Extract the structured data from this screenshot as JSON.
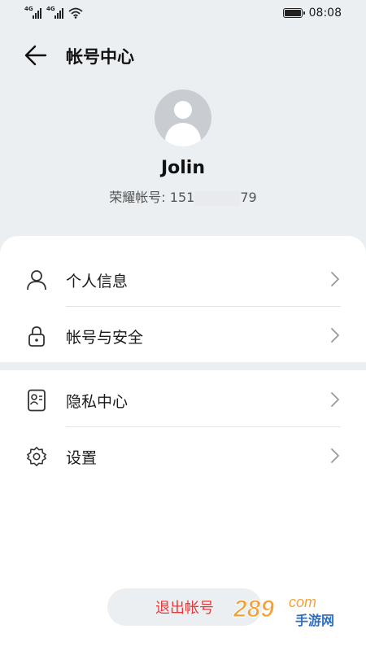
{
  "status_bar": {
    "network_1": "4G",
    "network_2": "4G",
    "time": "08:08",
    "icons": [
      "signal-icon",
      "signal-icon",
      "wifi-icon",
      "battery-icon"
    ]
  },
  "header": {
    "back_icon": "arrow-left-icon",
    "title": "帐号中心"
  },
  "profile": {
    "avatar_icon": "default-avatar-icon",
    "name": "Jolin",
    "account_label": "荣耀帐号: ",
    "account_prefix": "151",
    "account_suffix": "79"
  },
  "menu_group_1": [
    {
      "icon": "person-icon",
      "label": "个人信息"
    },
    {
      "icon": "lock-icon",
      "label": "帐号与安全"
    }
  ],
  "menu_group_2": [
    {
      "icon": "id-card-icon",
      "label": "隐私中心"
    },
    {
      "icon": "gear-icon",
      "label": "设置"
    }
  ],
  "logout": {
    "label": "退出帐号",
    "color": "#e23a3a"
  },
  "watermark": {
    "text_main": "289",
    "text_com": "com",
    "text_sub": "手游网"
  },
  "colors": {
    "background": "#eceff2",
    "card": "#ffffff",
    "danger": "#e23a3a"
  }
}
